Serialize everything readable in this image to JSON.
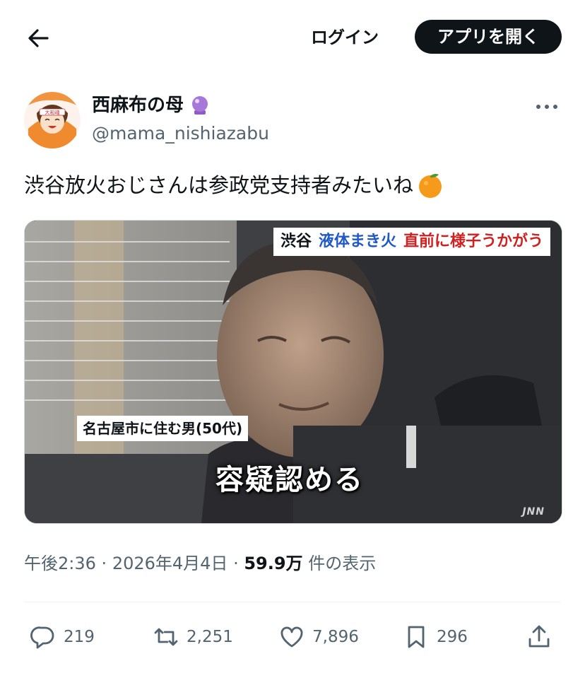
{
  "header": {
    "back_icon": "arrow-left-icon",
    "login_label": "ログイン",
    "open_app_label": "アプリを開く"
  },
  "author": {
    "name": "西麻布の母",
    "badge_icon": "crystal-ball-emoji",
    "handle": "@mama_nishiazabu",
    "avatar_text": "大和魂"
  },
  "tweet": {
    "text": "渋谷放火おじさんは参政党支持者みたいね",
    "emoji": "tangerine-emoji"
  },
  "media": {
    "caption_top": [
      "渋谷",
      "液体まき火",
      "直前に様子うかがう"
    ],
    "caption_left": "名古屋市に住む男(50代)",
    "caption_center": "容疑認める",
    "watermark": "JNN"
  },
  "meta": {
    "time": "午後2:36",
    "date": "2026年4月4日",
    "views": "59.9万",
    "views_label": "件の表示"
  },
  "actions": {
    "replies": "219",
    "retweets": "2,251",
    "likes": "7,896",
    "bookmarks": "296"
  },
  "colors": {
    "text": "#0f1419",
    "muted": "#536471",
    "button_bg": "#0f1419",
    "caption_blue": "#1f58c9",
    "caption_red": "#d0201f"
  }
}
